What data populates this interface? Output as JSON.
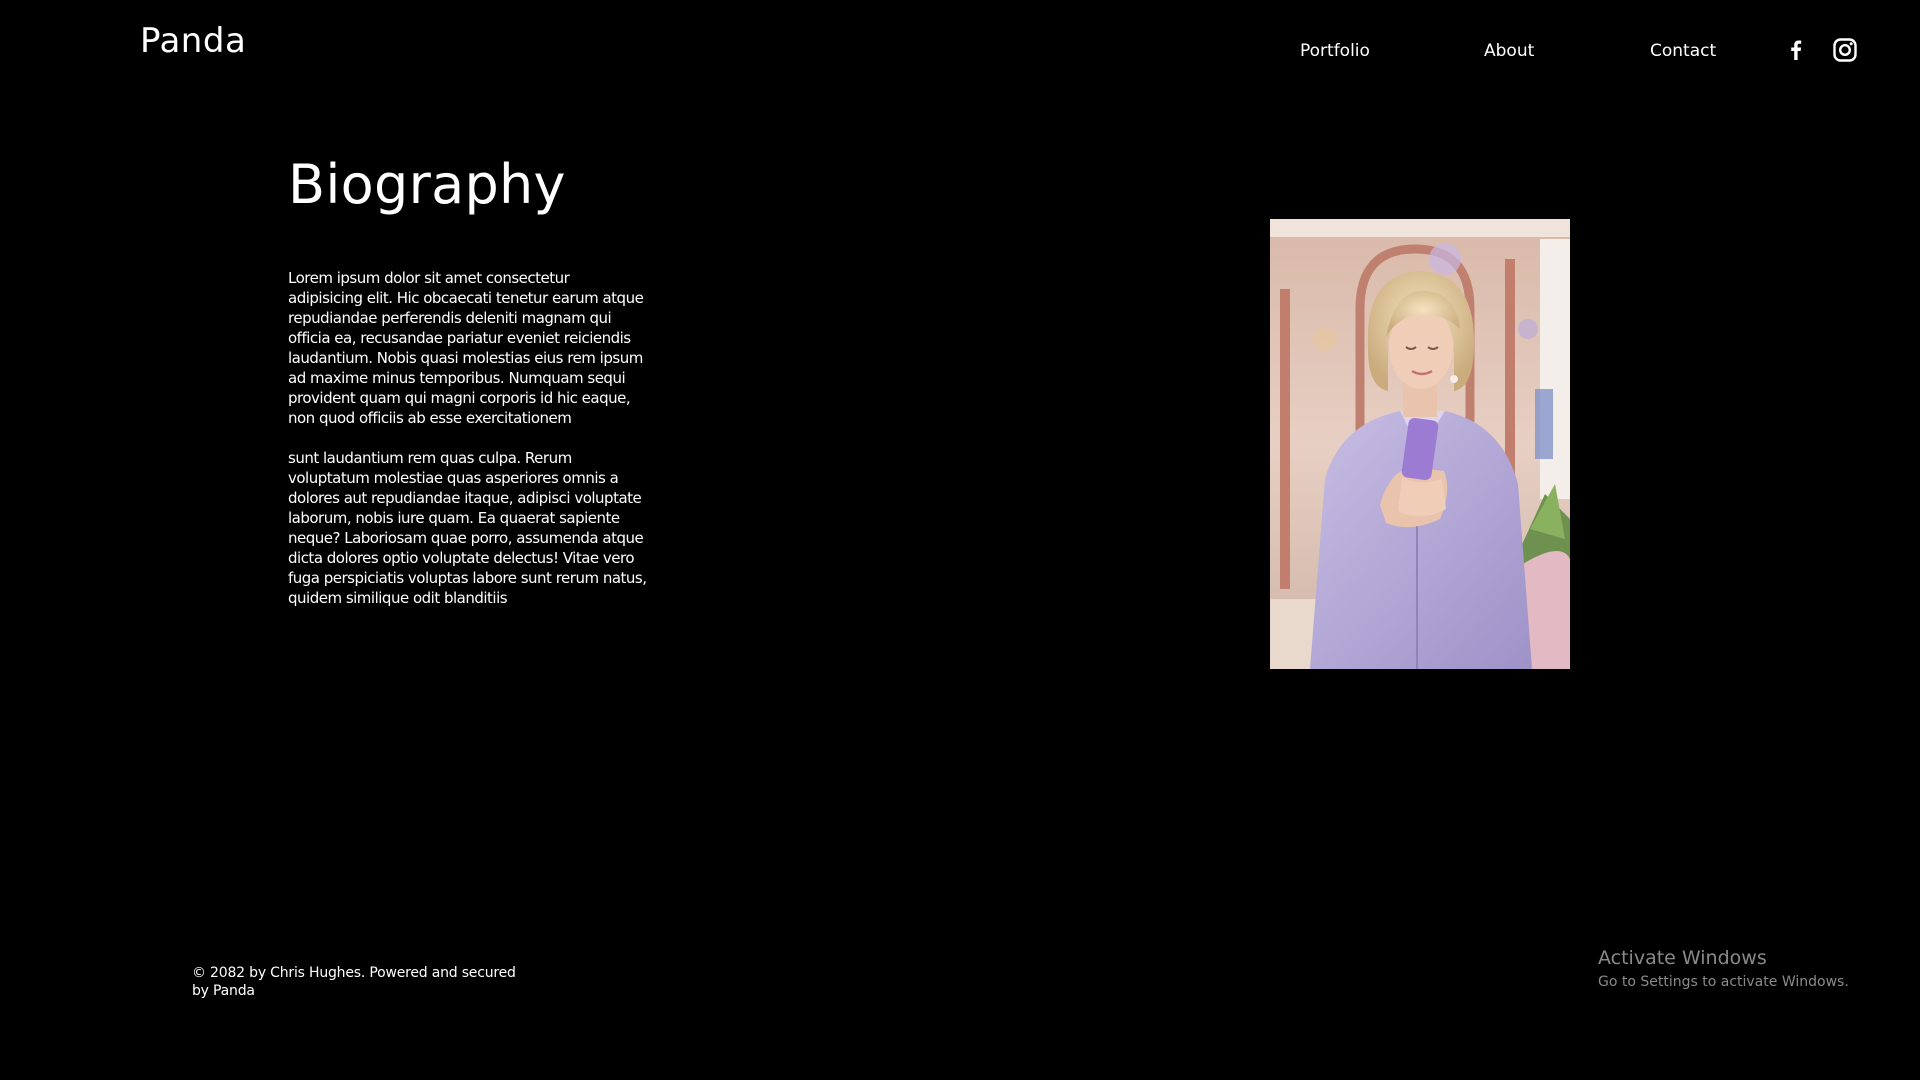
{
  "site": {
    "logo": "Panda"
  },
  "nav": {
    "items": [
      {
        "label": "Portfolio"
      },
      {
        "label": "About"
      },
      {
        "label": "Contact"
      }
    ],
    "social": [
      {
        "icon": "facebook-icon"
      },
      {
        "icon": "instagram-icon"
      }
    ]
  },
  "main": {
    "title": "Biography",
    "paragraphs": [
      "Lorem ipsum dolor sit amet consectetur adipisicing elit. Hic obcaecati tenetur earum atque repudiandae perferendis deleniti magnam qui officia ea, recusandae pariatur eveniet reiciendis laudantium. Nobis quasi molestias eius rem ipsum ad maxime minus temporibus. Numquam sequi provident quam qui magni corporis id hic eaque, non quod officiis ab esse exercitationem",
      "sunt laudantium rem quas culpa. Rerum voluptatum molestiae quas asperiores omnis a dolores aut repudiandae itaque, adipisci voluptate laborum, nobis iure quam. Ea quaerat sapiente neque? Laboriosam quae porro, assumenda atque dicta dolores optio voluptate delectus! Vitae vero fuga perspiciatis voluptas labore sunt rerum natus, quidem similique odit blanditiis"
    ]
  },
  "footer": {
    "text": "© 2082 by Chris Hughes. Powered and secured by Panda"
  },
  "watermark": {
    "title": "Activate Windows",
    "subtitle": "Go to Settings to activate Windows."
  },
  "colors": {
    "background": "#000000",
    "text": "#ffffff",
    "watermark": "#8a8a8a"
  }
}
